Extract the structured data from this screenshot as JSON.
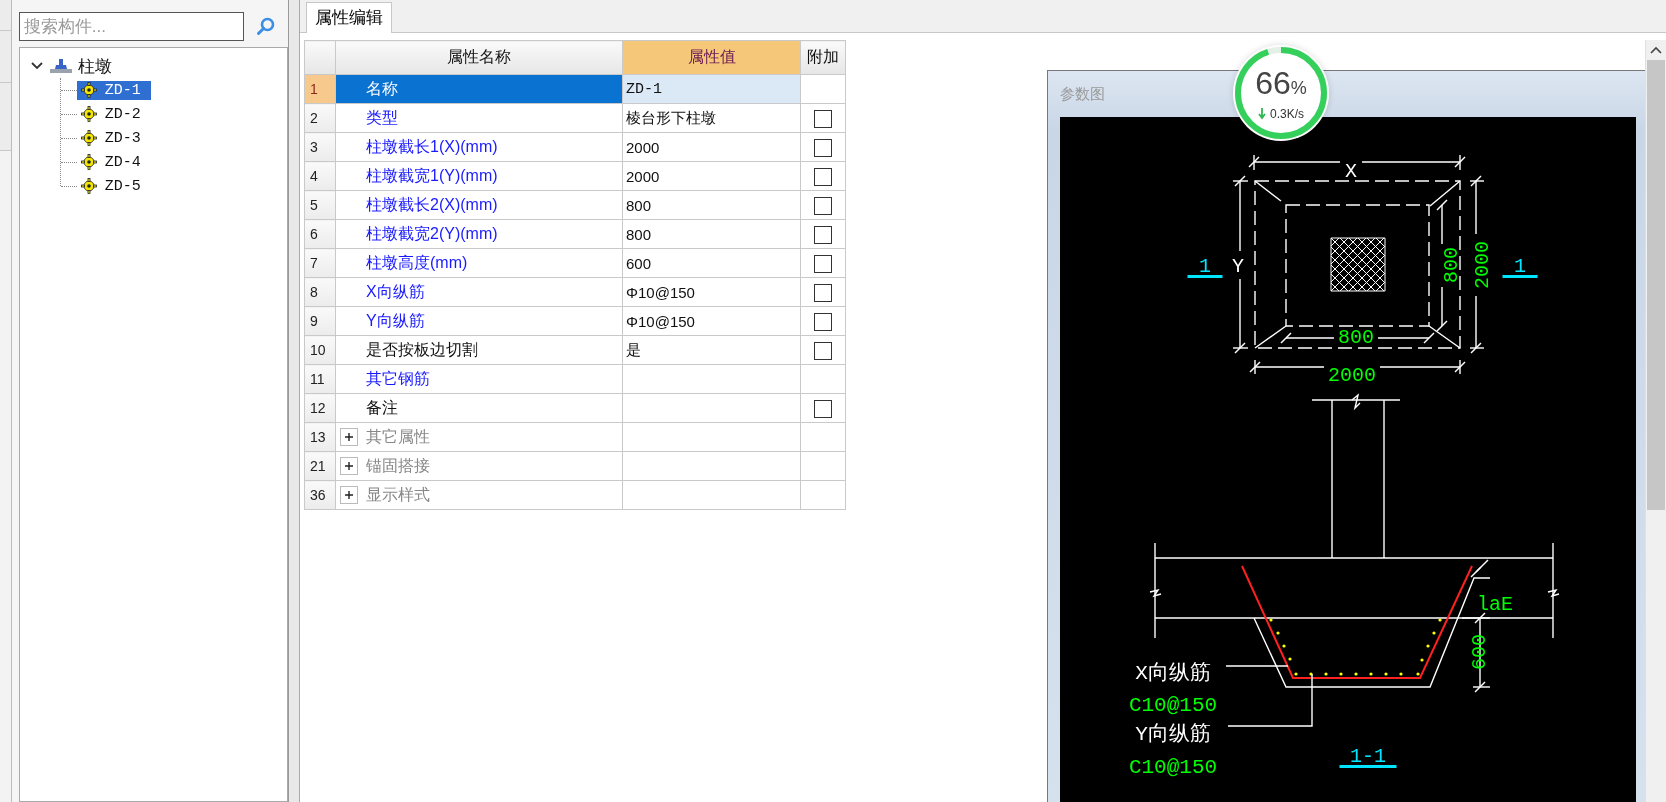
{
  "search": {
    "placeholder": "搜索构件..."
  },
  "tree": [
    {
      "label": "柱墩",
      "expanded": true,
      "children": [
        {
          "label": "ZD-1",
          "selected": true
        },
        {
          "label": "ZD-2",
          "selected": false
        },
        {
          "label": "ZD-3",
          "selected": false
        },
        {
          "label": "ZD-4",
          "selected": false
        },
        {
          "label": "ZD-5",
          "selected": false
        }
      ]
    }
  ],
  "tabs": [
    {
      "label": "属性编辑",
      "selected": true
    }
  ],
  "table": {
    "columns": [
      "属性名称",
      "属性值",
      "附加"
    ],
    "rows": [
      {
        "kind": "property",
        "number": "1",
        "name": "名称",
        "value": "ZD-1",
        "emphasized": false,
        "selected": true
      },
      {
        "kind": "property",
        "number": "2",
        "name": "类型",
        "value": "棱台形下柱墩",
        "emphasized": true,
        "selected": false,
        "checked": false
      },
      {
        "kind": "property",
        "number": "3",
        "name": "柱墩截长1(X)(mm)",
        "value": "2000",
        "emphasized": true,
        "selected": false,
        "checked": false
      },
      {
        "kind": "property",
        "number": "4",
        "name": "柱墩截宽1(Y)(mm)",
        "value": "2000",
        "emphasized": true,
        "selected": false,
        "checked": false
      },
      {
        "kind": "property",
        "number": "5",
        "name": "柱墩截长2(X)(mm)",
        "value": "800",
        "emphasized": true,
        "selected": false,
        "checked": false
      },
      {
        "kind": "property",
        "number": "6",
        "name": "柱墩截宽2(Y)(mm)",
        "value": "800",
        "emphasized": true,
        "selected": false,
        "checked": false
      },
      {
        "kind": "property",
        "number": "7",
        "name": "柱墩高度(mm)",
        "value": "600",
        "emphasized": true,
        "selected": false,
        "checked": false
      },
      {
        "kind": "property",
        "number": "8",
        "name": "X向纵筋",
        "value": "Φ10@150",
        "emphasized": true,
        "selected": false,
        "checked": false
      },
      {
        "kind": "property",
        "number": "9",
        "name": "Y向纵筋",
        "value": "Φ10@150",
        "emphasized": true,
        "selected": false,
        "checked": false
      },
      {
        "kind": "property",
        "number": "10",
        "name": "是否按板边切割",
        "value": "是",
        "emphasized": false,
        "selected": false,
        "checked": false
      },
      {
        "kind": "property",
        "number": "11",
        "name": "其它钢筋",
        "emphasized": true,
        "selected": false
      },
      {
        "kind": "property",
        "number": "12",
        "name": "备注",
        "emphasized": false,
        "selected": false,
        "checked": false
      },
      {
        "kind": "group",
        "number": "13",
        "name": "其它属性",
        "expanded": false,
        "selected": false
      },
      {
        "kind": "group",
        "number": "21",
        "name": "锚固搭接",
        "expanded": false,
        "selected": false
      },
      {
        "kind": "group",
        "number": "36",
        "name": "显示样式",
        "expanded": false,
        "selected": false
      }
    ]
  },
  "diagram": {
    "title": "参数图",
    "labels": [
      {
        "kind": "axis",
        "text": "X"
      },
      {
        "kind": "axis",
        "text": "Y"
      },
      {
        "kind": "dimension",
        "text": "800"
      },
      {
        "kind": "dimension",
        "text": "2000"
      },
      {
        "kind": "dimension",
        "text": "800"
      },
      {
        "kind": "dimension",
        "text": "2000"
      },
      {
        "kind": "section",
        "text": "1"
      },
      {
        "kind": "section",
        "text": "1"
      },
      {
        "kind": "dimension",
        "text": "laE"
      },
      {
        "kind": "dimension",
        "text": "600"
      },
      {
        "kind": "rebar_name",
        "text": "X向纵筋"
      },
      {
        "kind": "rebar_spec",
        "text": "C10@150"
      },
      {
        "kind": "rebar_name",
        "text": "Y向纵筋"
      },
      {
        "kind": "rebar_spec",
        "text": "C10@150"
      },
      {
        "kind": "section",
        "text": "1-1"
      }
    ]
  },
  "monitor": {
    "value": "66",
    "unit": "%",
    "speed": "0.3K/s",
    "level": 0.95
  }
}
